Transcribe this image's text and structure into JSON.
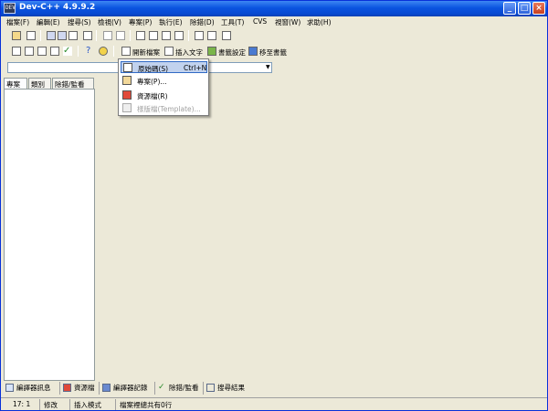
{
  "window": {
    "title": "Dev-C++ 4.9.9.2",
    "min": "_",
    "max": "□",
    "close": "×"
  },
  "menu": [
    "檔案(F)",
    "編輯(E)",
    "搜尋(S)",
    "檢視(V)",
    "專案(P)",
    "執行(E)",
    "除錯(D)",
    "工具(T)",
    "CVS",
    "視窗(W)",
    "求助(H)"
  ],
  "toolbar2": {
    "new_file": "開新檔案",
    "insert_text": "插入文字",
    "bookmark_set": "書籤設定",
    "goto_bookmark": "移至書籤"
  },
  "dropdown": {
    "items": [
      {
        "label": "原始碼(S)",
        "shortcut": "Ctrl+N"
      },
      {
        "label": "專案(P)..."
      },
      {
        "label": "資源檔(R)"
      },
      {
        "label": "樣版檔(Template)..."
      }
    ]
  },
  "left_tabs": [
    "專案",
    "類別",
    "除錯/監看"
  ],
  "bottom_tabs": [
    "編譯器訊息",
    "資源檔",
    "編譯器記錄",
    "除錯/監看",
    "搜尋結果"
  ],
  "status": {
    "position": "17: 1",
    "modified": "修改",
    "mode": "插入模式",
    "lines": "檔案裡總共有0行"
  },
  "colors": {
    "titlebar": "#0a54e0",
    "highlight": "#c1d2ee",
    "chrome": "#ece9d8"
  }
}
